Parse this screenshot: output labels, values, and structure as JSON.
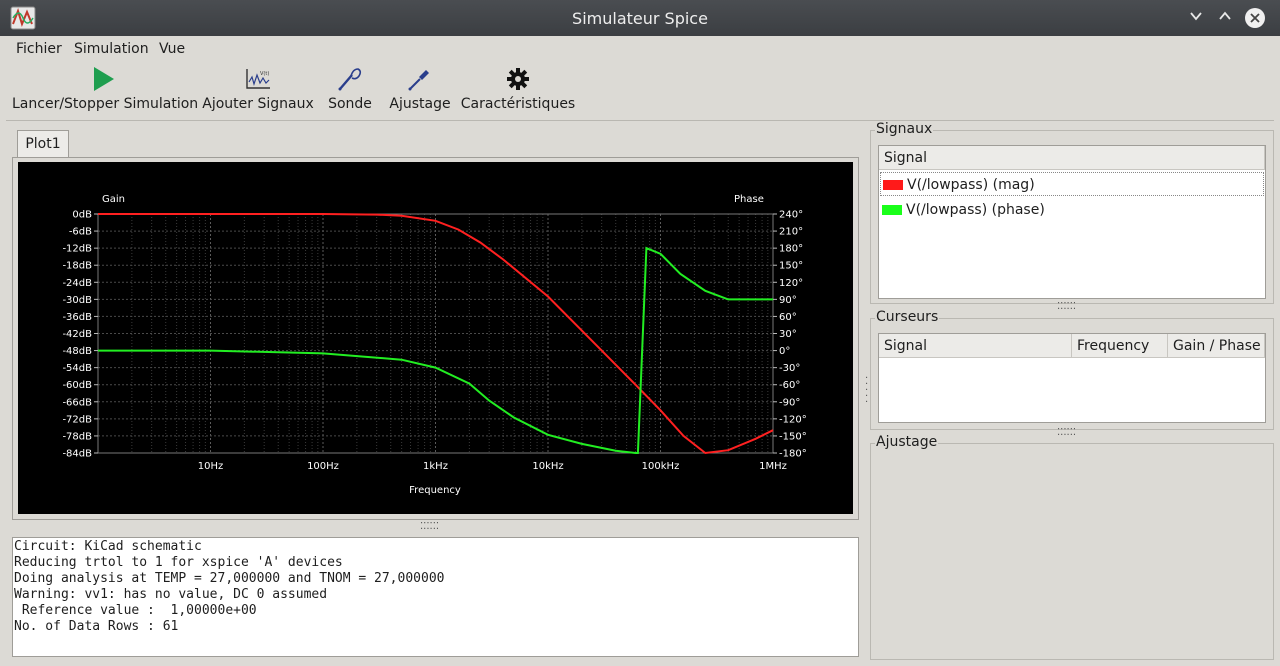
{
  "window": {
    "title": "Simulateur Spice"
  },
  "menu": [
    "Fichier",
    "Simulation",
    "Vue"
  ],
  "toolbar": {
    "run": "Lancer/Stopper Simulation",
    "add_signals": "Ajouter Signaux",
    "probe": "Sonde",
    "tune": "Ajustage",
    "settings": "Caractéristiques"
  },
  "plot": {
    "tab": "Plot1",
    "left_axis_title": "Gain",
    "right_axis_title": "Phase",
    "x_axis_title": "Frequency"
  },
  "chart_data": {
    "type": "line",
    "xscale": "log",
    "xlim": [
      1,
      1000000
    ],
    "ylim_left": [
      -84,
      0
    ],
    "ylim_right": [
      -180,
      240
    ],
    "x_ticks": [
      "10Hz",
      "100Hz",
      "1kHz",
      "10kHz",
      "100kHz",
      "1MHz"
    ],
    "y_left_ticks": [
      "0dB",
      "-6dB",
      "-12dB",
      "-18dB",
      "-24dB",
      "-30dB",
      "-36dB",
      "-42dB",
      "-48dB",
      "-54dB",
      "-60dB",
      "-66dB",
      "-72dB",
      "-78dB",
      "-84dB"
    ],
    "y_right_ticks": [
      "240°",
      "210°",
      "180°",
      "150°",
      "120°",
      "90°",
      "60°",
      "30°",
      "0°",
      "-30°",
      "-60°",
      "-90°",
      "-120°",
      "-150°",
      "-180°"
    ],
    "grid": true,
    "series": [
      {
        "name": "V(/lowpass) (mag)",
        "axis": "left",
        "color": "#ff2020",
        "x": [
          1,
          100,
          300,
          500,
          1000,
          1600,
          2500,
          4000,
          10000,
          30000,
          60000,
          100000,
          160000,
          250000,
          400000,
          700000,
          1000000
        ],
        "y": [
          0,
          0,
          -0.2,
          -0.6,
          -2.4,
          -5.5,
          -10,
          -16,
          -29,
          -48,
          -60,
          -69,
          -78,
          -84,
          -83,
          -79,
          -76
        ]
      },
      {
        "name": "V(/lowpass) (phase)",
        "axis": "left_phase",
        "color": "#22ee22",
        "x": [
          1,
          10,
          100,
          500,
          1000,
          2000,
          3000,
          5000,
          10000,
          20000,
          40000,
          60000,
          63000,
          75000,
          100000,
          150000,
          250000,
          400000,
          1000000
        ],
        "y": [
          0,
          0,
          -5,
          -16,
          -30,
          -58,
          -88,
          -118,
          -148,
          -164,
          -176,
          -180,
          -180,
          180,
          170,
          135,
          105,
          90,
          90
        ]
      }
    ]
  },
  "console_lines": [
    "Circuit: KiCad schematic",
    "Reducing trtol to 1 for xspice 'A' devices",
    "Doing analysis at TEMP = 27,000000 and TNOM = 27,000000",
    "Warning: vv1: has no value, DC 0 assumed",
    " Reference value :  1,00000e+00",
    "No. of Data Rows : 61"
  ],
  "signals": {
    "title": "Signaux",
    "header": "Signal",
    "items": [
      {
        "label": "V(/lowpass) (mag)",
        "color": "#ff1a1a"
      },
      {
        "label": "V(/lowpass) (phase)",
        "color": "#1aff1a"
      }
    ]
  },
  "cursors": {
    "title": "Curseurs",
    "headers": [
      "Signal",
      "Frequency",
      "Gain / Phase"
    ]
  },
  "tuning": {
    "title": "Ajustage"
  }
}
